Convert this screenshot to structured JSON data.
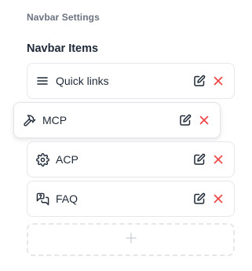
{
  "header": {
    "section_title": "Navbar Settings",
    "group_title": "Navbar Items"
  },
  "items": [
    {
      "label": "Quick links",
      "icon": "menu-icon",
      "state": "default"
    },
    {
      "label": "MCP",
      "icon": "hammer-icon",
      "state": "dragging"
    },
    {
      "label": "ACP",
      "icon": "gear-icon",
      "state": "default"
    },
    {
      "label": "FAQ",
      "icon": "question-chat-icon",
      "state": "default"
    }
  ],
  "item_actions": [
    "edit-icon",
    "delete-icon"
  ],
  "add_slot": {
    "icon": "plus-icon"
  },
  "colors": {
    "text": "#1f2937",
    "muted": "#6b7280",
    "border": "#e5e7eb",
    "edit": "#1f2937",
    "delete": "#ef4444",
    "plus": "#d1d5db"
  }
}
